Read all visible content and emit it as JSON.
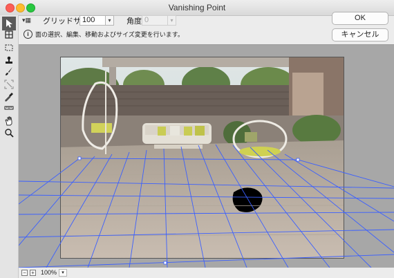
{
  "window": {
    "title": "Vanishing Point"
  },
  "tools": [
    {
      "icon": "edit-plane-icon"
    },
    {
      "icon": "create-plane-icon"
    },
    {
      "icon": "marquee-icon"
    },
    {
      "icon": "stamp-icon"
    },
    {
      "icon": "brush-icon"
    },
    {
      "icon": "transform-icon"
    },
    {
      "icon": "eyedropper-icon"
    },
    {
      "icon": "measure-icon"
    },
    {
      "icon": "hand-icon"
    },
    {
      "icon": "zoom-icon"
    }
  ],
  "options": {
    "grid_size_label": "グリッドサイズ：",
    "grid_size_value": "100",
    "angle_label": "角度：",
    "angle_value": "0"
  },
  "info": {
    "text": "面の選択、編集、移動およびサイズ変更を行います。"
  },
  "buttons": {
    "ok": "OK",
    "cancel": "キャンセル"
  },
  "status": {
    "zoom_out": "−",
    "zoom_in": "+",
    "zoom": "100%"
  },
  "colors": {
    "grid": "#3a5fff",
    "accent": "#5a5a5a"
  }
}
